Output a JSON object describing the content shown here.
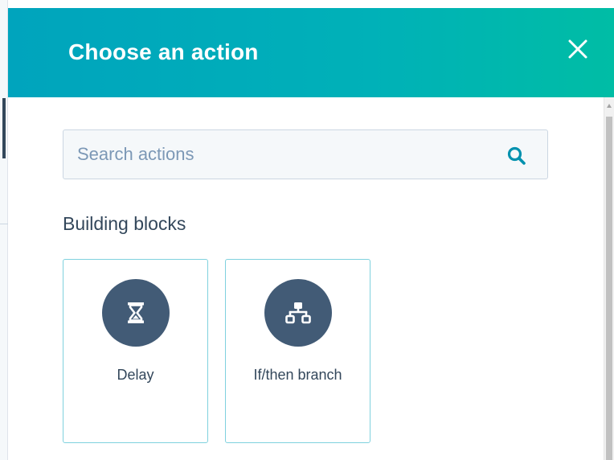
{
  "panel": {
    "title": "Choose an action",
    "close_icon": "close-icon"
  },
  "search": {
    "placeholder": "Search actions",
    "value": "",
    "icon": "search-icon"
  },
  "sections": [
    {
      "title": "Building blocks",
      "actions": [
        {
          "label": "Delay",
          "icon": "hourglass-icon"
        },
        {
          "label": "If/then branch",
          "icon": "branch-icon"
        }
      ]
    }
  ],
  "colors": {
    "header_gradient_start": "#00a4bd",
    "header_gradient_end": "#00bda5",
    "icon_circle": "#425b76",
    "card_border": "#7fd1de",
    "text": "#33475b",
    "placeholder": "#7c98b6",
    "search_icon": "#0091ae"
  }
}
